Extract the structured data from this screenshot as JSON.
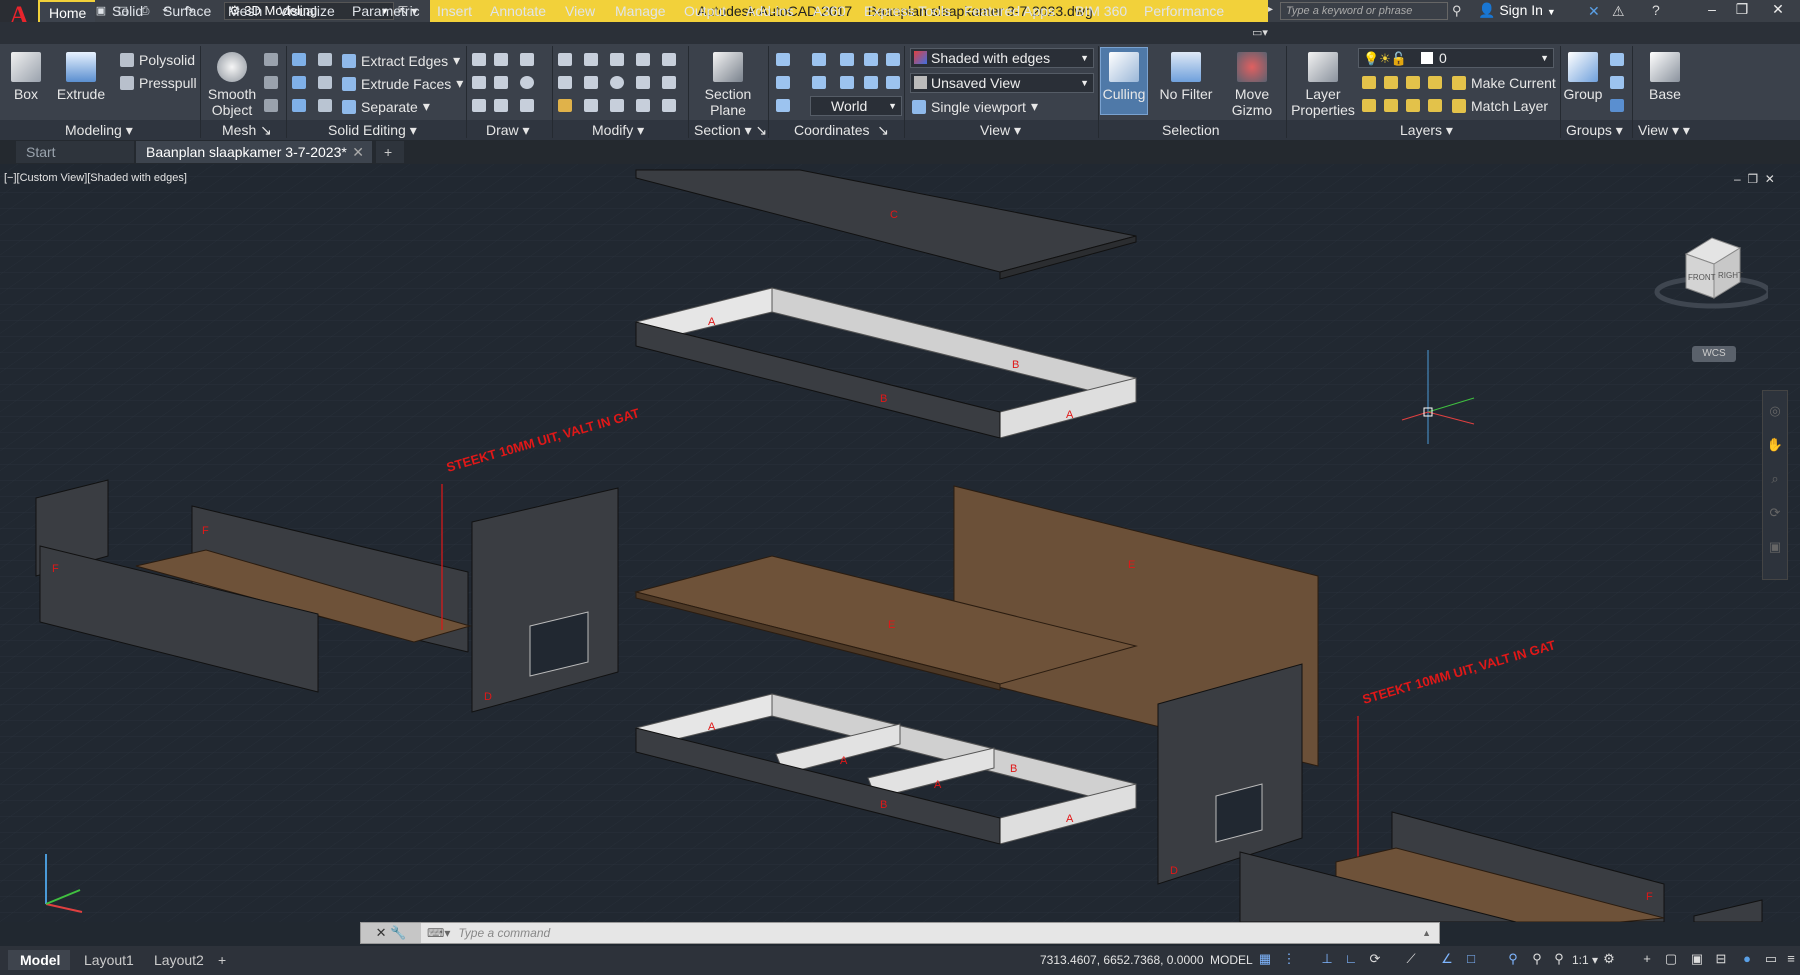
{
  "app": {
    "title": "Autodesk AutoCAD 2017",
    "filename": "Baanplan slaapkamer 3-7-2023.dwg",
    "workspace": "3D Modeling",
    "search_placeholder": "Type a keyword or phrase",
    "sign_in": "Sign In",
    "logo_letter": "A"
  },
  "menu_tabs": [
    "Home",
    "Solid",
    "Surface",
    "Mesh",
    "Visualize",
    "Parametric",
    "Insert",
    "Annotate",
    "View",
    "Manage",
    "Output",
    "Add-ins",
    "A360",
    "Express Tools",
    "Featured Apps",
    "BIM 360",
    "Performance"
  ],
  "ribbon": {
    "modeling": {
      "box": "Box",
      "extrude": "Extrude",
      "polysolid": "Polysolid",
      "presspull": "Presspull",
      "label": "Modeling"
    },
    "mesh": {
      "smooth": "Smooth",
      "object": "Object",
      "label": "Mesh"
    },
    "solid_editing": {
      "extract_edges": "Extract Edges",
      "extrude_faces": "Extrude Faces",
      "separate": "Separate",
      "label": "Solid Editing"
    },
    "draw": {
      "label": "Draw"
    },
    "modify": {
      "label": "Modify"
    },
    "section": {
      "plane": "Section",
      "plane2": "Plane",
      "label": "Section"
    },
    "coordinates": {
      "world": "World",
      "label": "Coordinates"
    },
    "view": {
      "visual_style": "Shaded with edges",
      "named_view": "Unsaved View",
      "viewport": "Single viewport",
      "label": "View"
    },
    "selection": {
      "culling": "Culling",
      "nofilter": "No Filter",
      "gizmo1": "Move",
      "gizmo2": "Gizmo",
      "label": "Selection"
    },
    "layers": {
      "properties": "Layer",
      "properties2": "Properties",
      "current_layer": "0",
      "make_current": "Make Current",
      "match_layer": "Match Layer",
      "label": "Layers"
    },
    "groups": {
      "group": "Group",
      "label": "Groups"
    },
    "view2": {
      "base": "Base",
      "label": "View"
    }
  },
  "doc_tabs": [
    "Start",
    "Baanplan slaapkamer 3-7-2023*"
  ],
  "viewport": {
    "label": "[−][Custom View][Shaded with edges]",
    "wcs": "WCS",
    "cube_front": "FRONT",
    "cube_right": "RIGHT",
    "annotation": "STEEKT 10MM UIT, VALT IN GAT",
    "part_labels": {
      "a": "A",
      "b": "B",
      "c": "C",
      "d": "D",
      "e": "E",
      "f": "F"
    }
  },
  "command": {
    "placeholder": "Type a command"
  },
  "status": {
    "layout_tabs": [
      "Model",
      "Layout1",
      "Layout2"
    ],
    "coordinates": "7313.4607, 6652.7368, 0.0000",
    "mode": "MODEL",
    "scale": "1:1"
  },
  "colors": {
    "title_bar": "#f2d13a",
    "wood": "#6b5038",
    "panel": "#3a3d42",
    "frame": "#d8d8d8",
    "annotation": "#e01818"
  }
}
